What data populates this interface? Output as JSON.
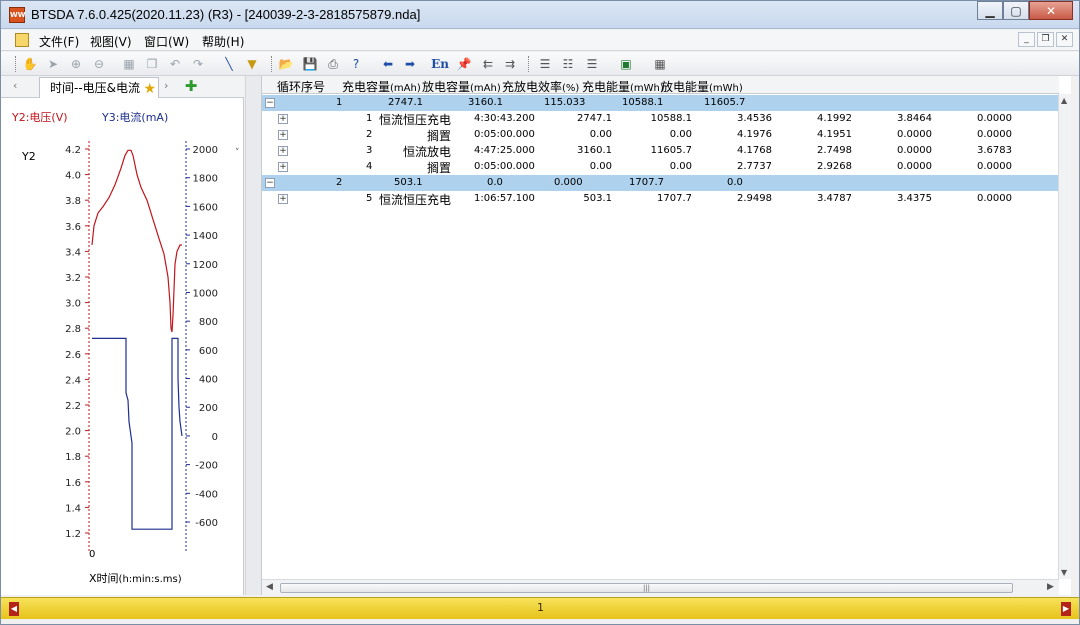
{
  "window": {
    "title": "BTSDA 7.6.0.425(2020.11.23) (R3) - [240039-2-3-2818575879.nda]",
    "app_icon_text": "WW"
  },
  "menu": [
    "文件(F)",
    "视图(V)",
    "窗口(W)",
    "帮助(H)"
  ],
  "toolbar": {
    "en_label": "En",
    "icons": [
      "hand-icon",
      "pointer-icon",
      "zoom-in-icon",
      "zoom-out-icon",
      "fit-icon",
      "copy-icon",
      "undo-icon",
      "redo-icon",
      "line-icon",
      "filter-icon",
      "open-icon",
      "save-icon",
      "print-icon",
      "help-icon",
      "back-icon",
      "forward-icon",
      "language-icon",
      "pin-icon",
      "align-left-icon",
      "align-right-icon",
      "list-view-icon",
      "detail-view-icon",
      "record-view-icon",
      "excel-icon",
      "qr-icon"
    ]
  },
  "left": {
    "tab_label": "时间--电压&电流",
    "legend_y2": "Y2:电压(V)",
    "legend_y3": "Y3:电流(mA)",
    "y2_axis_name": "Y2",
    "x_zero": "0",
    "x_label_main": "X时间",
    "x_label_unit": "(h:min:s.ms)",
    "colors": {
      "voltage": "#c0151b",
      "current": "#1d2f8f"
    }
  },
  "chart_data": {
    "type": "line",
    "series": [
      {
        "name": "Y2:电压(V)",
        "axis": "left",
        "color": "#c0151b"
      },
      {
        "name": "Y3:电流(mA)",
        "axis": "right",
        "color": "#1d2f8f"
      }
    ],
    "y_left_ticks": [
      "4.2",
      "4.0",
      "3.8",
      "3.6",
      "3.4",
      "3.2",
      "3.0",
      "2.8",
      "2.6",
      "2.4",
      "2.2",
      "2.0",
      "1.8",
      "1.6",
      "1.4",
      "1.2"
    ],
    "y_right_ticks": [
      "2000",
      "1800",
      "1600",
      "1400",
      "1200",
      "1000",
      "800",
      "600",
      "400",
      "200",
      "0",
      "-200",
      "-400",
      "-600"
    ],
    "ylim_left": [
      1.2,
      4.2
    ],
    "ylim_right": [
      -700,
      2000
    ]
  },
  "grid": {
    "headers": [
      {
        "main": "循环序号",
        "unit": ""
      },
      {
        "main": "充电容量",
        "unit": "(mAh)"
      },
      {
        "main": "放电容量",
        "unit": "(mAh)"
      },
      {
        "main": "充放电效率",
        "unit": "(%)"
      },
      {
        "main": "充电能量",
        "unit": "(mWh)"
      },
      {
        "main": "放电能量",
        "unit": "(mWh)"
      }
    ],
    "cycles": [
      {
        "toggle": "−",
        "values": [
          "1",
          "2747.1",
          "3160.1",
          "115.033",
          "10588.1",
          "11605.7"
        ],
        "steps": [
          [
            "1",
            "恒流恒压充电",
            "4:30:43.200",
            "2747.1",
            "10588.1",
            "3.4536",
            "4.1992",
            "3.8464",
            "0.0000"
          ],
          [
            "2",
            "搁置",
            "0:05:00.000",
            "0.00",
            "0.00",
            "4.1976",
            "4.1951",
            "0.0000",
            "0.0000"
          ],
          [
            "3",
            "恒流放电",
            "4:47:25.000",
            "3160.1",
            "11605.7",
            "4.1768",
            "2.7498",
            "0.0000",
            "3.6783"
          ],
          [
            "4",
            "搁置",
            "0:05:00.000",
            "0.00",
            "0.00",
            "2.7737",
            "2.9268",
            "0.0000",
            "0.0000"
          ]
        ]
      },
      {
        "toggle": "−",
        "values": [
          "2",
          "503.1",
          "0.0",
          "0.000",
          "1707.7",
          "0.0"
        ],
        "steps": [
          [
            "5",
            "恒流恒压充电",
            "1:06:57.100",
            "503.1",
            "1707.7",
            "2.9498",
            "3.4787",
            "3.4375",
            "0.0000"
          ]
        ]
      }
    ],
    "step_toggle": "+",
    "scroll_grip": "|||"
  },
  "status": {
    "value": "1"
  }
}
